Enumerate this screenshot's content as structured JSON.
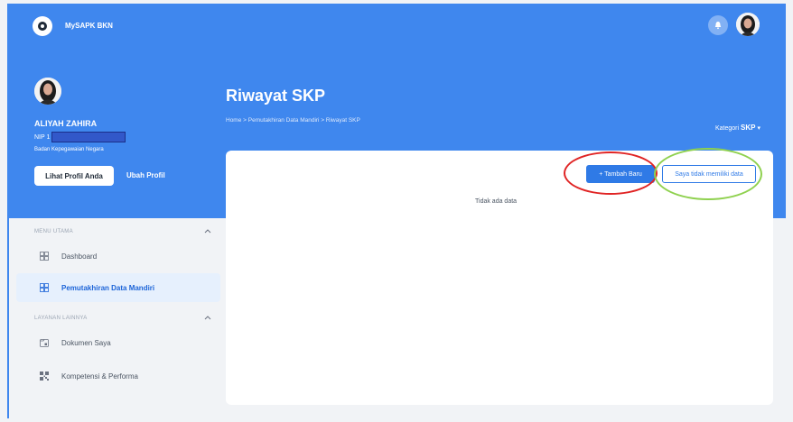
{
  "app": {
    "title": "MySAPK BKN"
  },
  "profile": {
    "name": "ALIYAH ZAHIRA",
    "nip_label": "NIP 1",
    "organization": "Badan Kepegawaian Negara",
    "view_profile_label": "Lihat Profil Anda",
    "edit_profile_label": "Ubah Profil"
  },
  "page": {
    "title": "Riwayat SKP",
    "breadcrumb": "Home  >  Pemutakhiran Data Mandiri  >  Riwayat SKP",
    "kategori_label": "Kategori",
    "kategori_value": "SKP"
  },
  "sidebar": {
    "sections": [
      {
        "title": "MENU UTAMA",
        "items": [
          {
            "label": "Dashboard",
            "icon": "grid-icon",
            "active": false
          },
          {
            "label": "Pemutakhiran Data Mandiri",
            "icon": "grid-icon",
            "active": true
          }
        ]
      },
      {
        "title": "LAYANAN LAINNYA",
        "items": [
          {
            "label": "Dokumen Saya",
            "icon": "document-icon",
            "active": false
          },
          {
            "label": "Kompetensi & Performa",
            "icon": "qr-icon",
            "active": false
          }
        ]
      }
    ]
  },
  "content": {
    "add_button_label": "+  Tambah Baru",
    "no_data_button_label": "Saya tidak memiliki data",
    "empty_text": "Tidak ada data"
  },
  "colors": {
    "header_blue": "#3f87ee",
    "primary": "#2f7ae6",
    "annotation_red": "#e02424",
    "annotation_green": "#8fd14f"
  }
}
